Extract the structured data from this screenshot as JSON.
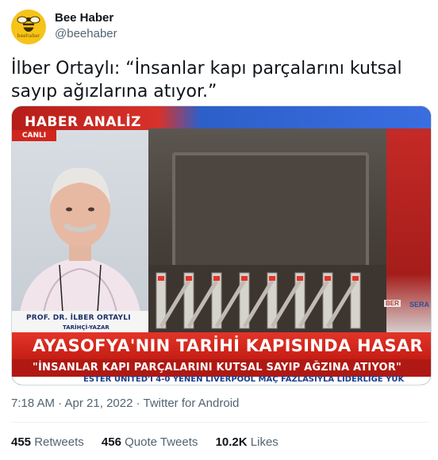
{
  "account": {
    "name": "Bee Haber",
    "handle": "@beehaber",
    "avatar_text": "beehaber",
    "avatar_color": "#f6c318"
  },
  "tweet": {
    "text": "İlber Ortaylı: “İnsanlar kapı parçalarını kutsal sayıp ağızlarına atıyor.”"
  },
  "media": {
    "program": "HABER ANALİZ",
    "live": "CANLI",
    "guest_name": "PROF. DR. İLBER ORTAYLI",
    "guest_title": "TARİHÇİ-YAZAR",
    "headline": "AYASOFYA'NIN TARİHİ KAPISINDA HASAR",
    "subheadline": "\"İNSANLAR KAPI PARÇALARINI KUTSAL SAYIP AĞZINA ATIYOR\"",
    "ticker": "ESTER UNITED'I 4-0 YENEN LIVERPOOL MAÇ FAZLASIYLA LİDERLİĞE YÜK",
    "side_label": "SERA",
    "side_label2": "BER"
  },
  "meta": {
    "timestamp": "7:18 AM · Apr 21, 2022 · Twitter for Android"
  },
  "stats": {
    "retweets_count": "455",
    "retweets_label": "Retweets",
    "quotes_count": "456",
    "quotes_label": "Quote Tweets",
    "likes_count": "10.2K",
    "likes_label": "Likes"
  }
}
